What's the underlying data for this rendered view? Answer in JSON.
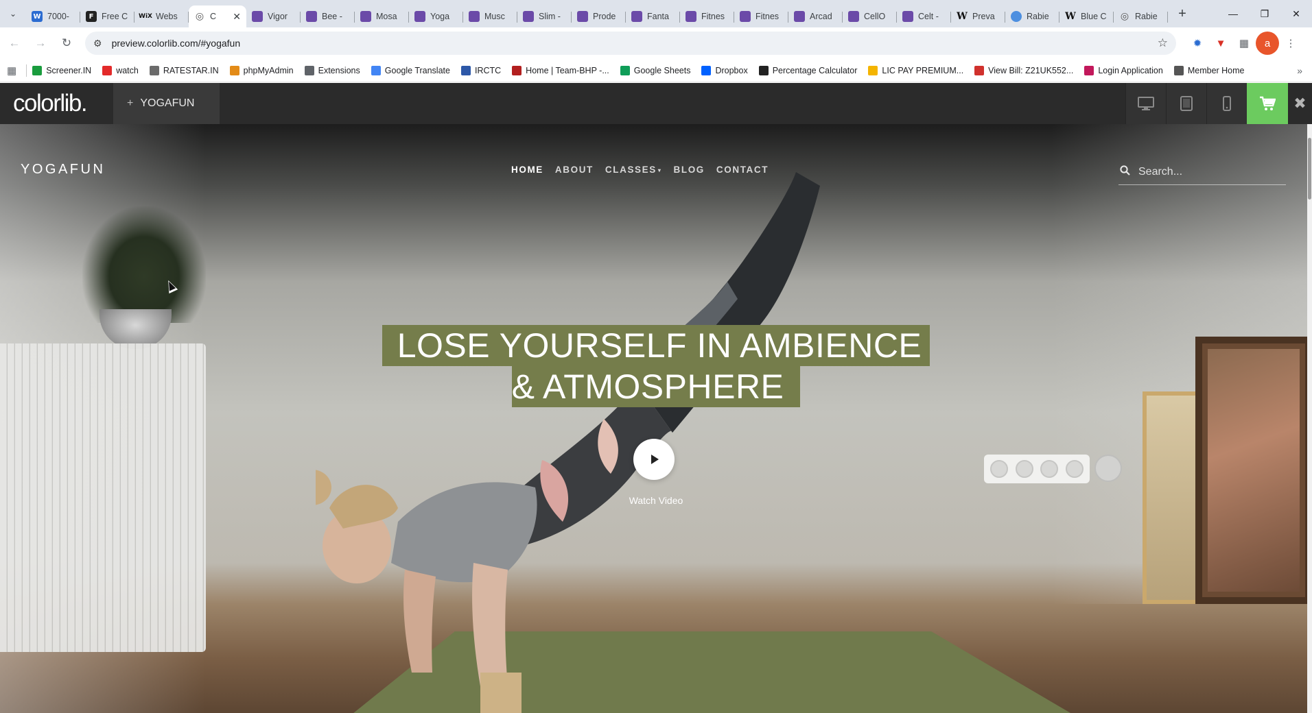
{
  "browser": {
    "tabs": [
      {
        "label": "7000-",
        "icon": "word-icon"
      },
      {
        "label": "Free C",
        "icon": "framer-icon"
      },
      {
        "label": "Webs",
        "icon": "wix-icon"
      },
      {
        "label": "C",
        "icon": "globe-icon",
        "active": true
      },
      {
        "label": "Vigor",
        "icon": "colorlib-icon"
      },
      {
        "label": "Bee -",
        "icon": "colorlib-icon"
      },
      {
        "label": "Mosa",
        "icon": "colorlib-icon"
      },
      {
        "label": "Yoga",
        "icon": "colorlib-icon"
      },
      {
        "label": "Musc",
        "icon": "colorlib-icon"
      },
      {
        "label": "Slim -",
        "icon": "colorlib-icon"
      },
      {
        "label": "Prode",
        "icon": "colorlib-icon"
      },
      {
        "label": "Fanta",
        "icon": "colorlib-icon"
      },
      {
        "label": "Fitnes",
        "icon": "colorlib-icon"
      },
      {
        "label": "Fitnes",
        "icon": "colorlib-icon"
      },
      {
        "label": "Arcad",
        "icon": "colorlib-icon"
      },
      {
        "label": "CellO",
        "icon": "colorlib-icon"
      },
      {
        "label": "Celt -",
        "icon": "colorlib-icon"
      },
      {
        "label": "Preva",
        "icon": "wikipedia-icon"
      },
      {
        "label": "Rabie",
        "icon": "who-icon"
      },
      {
        "label": "Blue C",
        "icon": "wikipedia-icon"
      },
      {
        "label": "Rabie",
        "icon": "globe-icon"
      }
    ],
    "url": "preview.colorlib.com/#yogafun",
    "profile_initial": "a",
    "bookmarks": [
      {
        "label": "Screener.IN",
        "color": "#1a9c3e"
      },
      {
        "label": "watch",
        "color": "#e32a2a"
      },
      {
        "label": "RATESTAR.IN",
        "color": "#6b6b6b"
      },
      {
        "label": "phpMyAdmin",
        "color": "#e38b17"
      },
      {
        "label": "Extensions",
        "color": "#5f6368"
      },
      {
        "label": "Google Translate",
        "color": "#4285f4"
      },
      {
        "label": "IRCTC",
        "color": "#2d58a8"
      },
      {
        "label": "Home | Team-BHP -...",
        "color": "#b21f1f"
      },
      {
        "label": "Google Sheets",
        "color": "#0f9d58"
      },
      {
        "label": "Dropbox",
        "color": "#0061ff"
      },
      {
        "label": "Percentage Calculator",
        "color": "#222222"
      },
      {
        "label": "LIC PAY PREMIUM...",
        "color": "#f4b400"
      },
      {
        "label": "View Bill: Z21UK552...",
        "color": "#d0312d"
      },
      {
        "label": "Login Application",
        "color": "#c2185b"
      },
      {
        "label": "Member Home",
        "color": "#555555"
      }
    ]
  },
  "colorlib": {
    "logo": "colorlib.",
    "theme_label": "YOGAFUN",
    "accent": "#6ccb5f"
  },
  "site": {
    "brand": "YOGAFUN",
    "nav": [
      {
        "label": "HOME",
        "current": true
      },
      {
        "label": "ABOUT"
      },
      {
        "label": "CLASSES",
        "dropdown": true
      },
      {
        "label": "BLOG"
      },
      {
        "label": "CONTACT"
      }
    ],
    "search_placeholder": "Search...",
    "headline_line1": "LOSE YOURSELF IN AMBIENCE",
    "headline_line2": "& ATMOSPHERE",
    "headline_bg": "#757d4b",
    "watch_label": "Watch Video"
  }
}
